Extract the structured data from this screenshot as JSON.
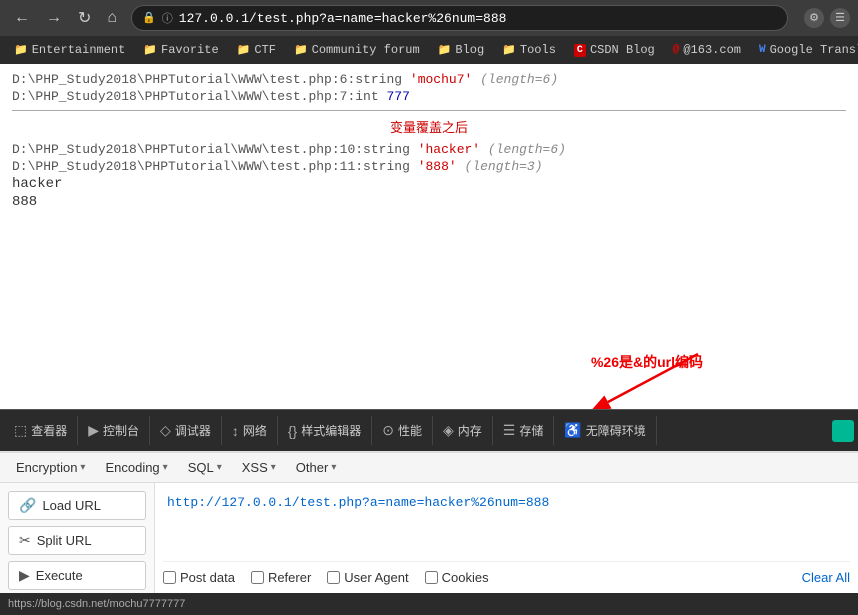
{
  "browser": {
    "url": "127.0.0.1/test.php?a=name=hacker%26num=888",
    "full_url": "① 127.0.0.1/test.php?a=name=hacker%26num=888"
  },
  "bookmarks": [
    {
      "label": "Entertainment",
      "icon": "📁"
    },
    {
      "label": "Favorite",
      "icon": "📁"
    },
    {
      "label": "CTF",
      "icon": "📁"
    },
    {
      "label": "Community forum",
      "icon": "📁"
    },
    {
      "label": "Blog",
      "icon": "📁"
    },
    {
      "label": "Tools",
      "icon": "📁"
    },
    {
      "label": "CSDN Blog",
      "icon": "C"
    },
    {
      "label": "@163.com",
      "icon": "@"
    },
    {
      "label": "Google Translate",
      "icon": "W"
    }
  ],
  "page": {
    "line1_path": "D:\\PHP_Study2018\\PHPTutorial\\WWW\\test.php:6:string",
    "line1_val": "'mochu7'",
    "line1_len": "(length=6)",
    "line2_path": "D:\\PHP_Study2018\\PHPTutorial\\WWW\\test.php:7:int",
    "line2_int": "777",
    "section_title": "变量覆盖之后",
    "line3_path": "D:\\PHP_Study2018\\PHPTutorial\\WWW\\test.php:10:string",
    "line3_val": "'hacker'",
    "line3_len": "(length=6)",
    "line4_path": "D:\\PHP_Study2018\\PHPTutorial\\WWW\\test.php:11:string",
    "line4_val": "'888'",
    "line4_len": "(length=3)",
    "output1": "hacker",
    "output2": "888"
  },
  "annotation": {
    "text": "%26是&的url编码"
  },
  "devtools": {
    "buttons": [
      {
        "label": "查看器",
        "icon": "⬚"
      },
      {
        "label": "控制台",
        "icon": "▶"
      },
      {
        "label": "调试器",
        "icon": "◇"
      },
      {
        "label": "网络",
        "icon": "↕"
      },
      {
        "label": "样式编辑器",
        "icon": "{}"
      },
      {
        "label": "性能",
        "icon": "⊙"
      },
      {
        "label": "内存",
        "icon": "◈"
      },
      {
        "label": "存储",
        "icon": "☰"
      },
      {
        "label": "无障碍环境",
        "icon": "♿"
      }
    ]
  },
  "hackbar": {
    "menus": [
      {
        "label": "Encryption",
        "has_arrow": true
      },
      {
        "label": "Encoding",
        "has_arrow": true
      },
      {
        "label": "SQL",
        "has_arrow": true
      },
      {
        "label": "XSS",
        "has_arrow": true
      },
      {
        "label": "Other",
        "has_arrow": true
      }
    ],
    "buttons": [
      {
        "label": "Load URL",
        "icon": "🔗"
      },
      {
        "label": "Split URL",
        "icon": "✂"
      },
      {
        "label": "Execute",
        "icon": "▶"
      }
    ],
    "url_value": "http://127.0.0.1/test.php?a=name=hacker%26num=888",
    "checkboxes": [
      {
        "label": "Post data"
      },
      {
        "label": "Referer"
      },
      {
        "label": "User Agent"
      },
      {
        "label": "Cookies"
      }
    ],
    "clear_all": "Clear All"
  },
  "status": {
    "url": "https://blog.csdn.net/mochu7777777"
  }
}
